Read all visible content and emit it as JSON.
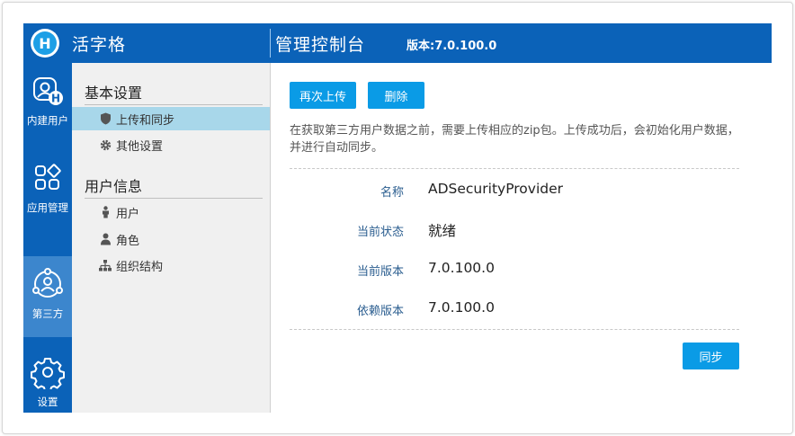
{
  "header": {
    "brand": "活字格",
    "logo_letter": "H",
    "console_title": "管理控制台",
    "version": "版本:7.0.100.0"
  },
  "rail": {
    "items": [
      {
        "label": "内建用户",
        "icon": "builtin-user-icon",
        "active": false
      },
      {
        "label": "应用管理",
        "icon": "apps-icon",
        "active": false
      },
      {
        "label": "第三方",
        "icon": "third-party-icon",
        "active": true
      },
      {
        "label": "设置",
        "icon": "gear-icon",
        "active": false
      }
    ]
  },
  "menu": {
    "sections": [
      {
        "title": "基本设置",
        "items": [
          {
            "label": "上传和同步",
            "icon": "shield-icon",
            "active": true
          },
          {
            "label": "其他设置",
            "icon": "gear-icon",
            "active": false
          }
        ]
      },
      {
        "title": "用户信息",
        "items": [
          {
            "label": "用户",
            "icon": "user-icon",
            "active": false
          },
          {
            "label": "角色",
            "icon": "role-icon",
            "active": false
          },
          {
            "label": "组织结构",
            "icon": "org-chart-icon",
            "active": false
          }
        ]
      }
    ]
  },
  "main": {
    "reupload_label": "再次上传",
    "delete_label": "删除",
    "notice": "在获取第三方用户数据之前，需要上传相应的zip包。上传成功后，会初始化用户数据，并进行自动同步。",
    "details": [
      {
        "label": "名称",
        "value": "ADSecurityProvider"
      },
      {
        "label": "当前状态",
        "value": "就绪"
      },
      {
        "label": "当前版本",
        "value": "7.0.100.0"
      },
      {
        "label": "依赖版本",
        "value": "7.0.100.0"
      }
    ],
    "sync_label": "同步"
  },
  "colors": {
    "primary": "#0b62b8",
    "rail_active": "#3c86cd",
    "button": "#0a9be6",
    "menu_active": "#a8d7ea"
  }
}
